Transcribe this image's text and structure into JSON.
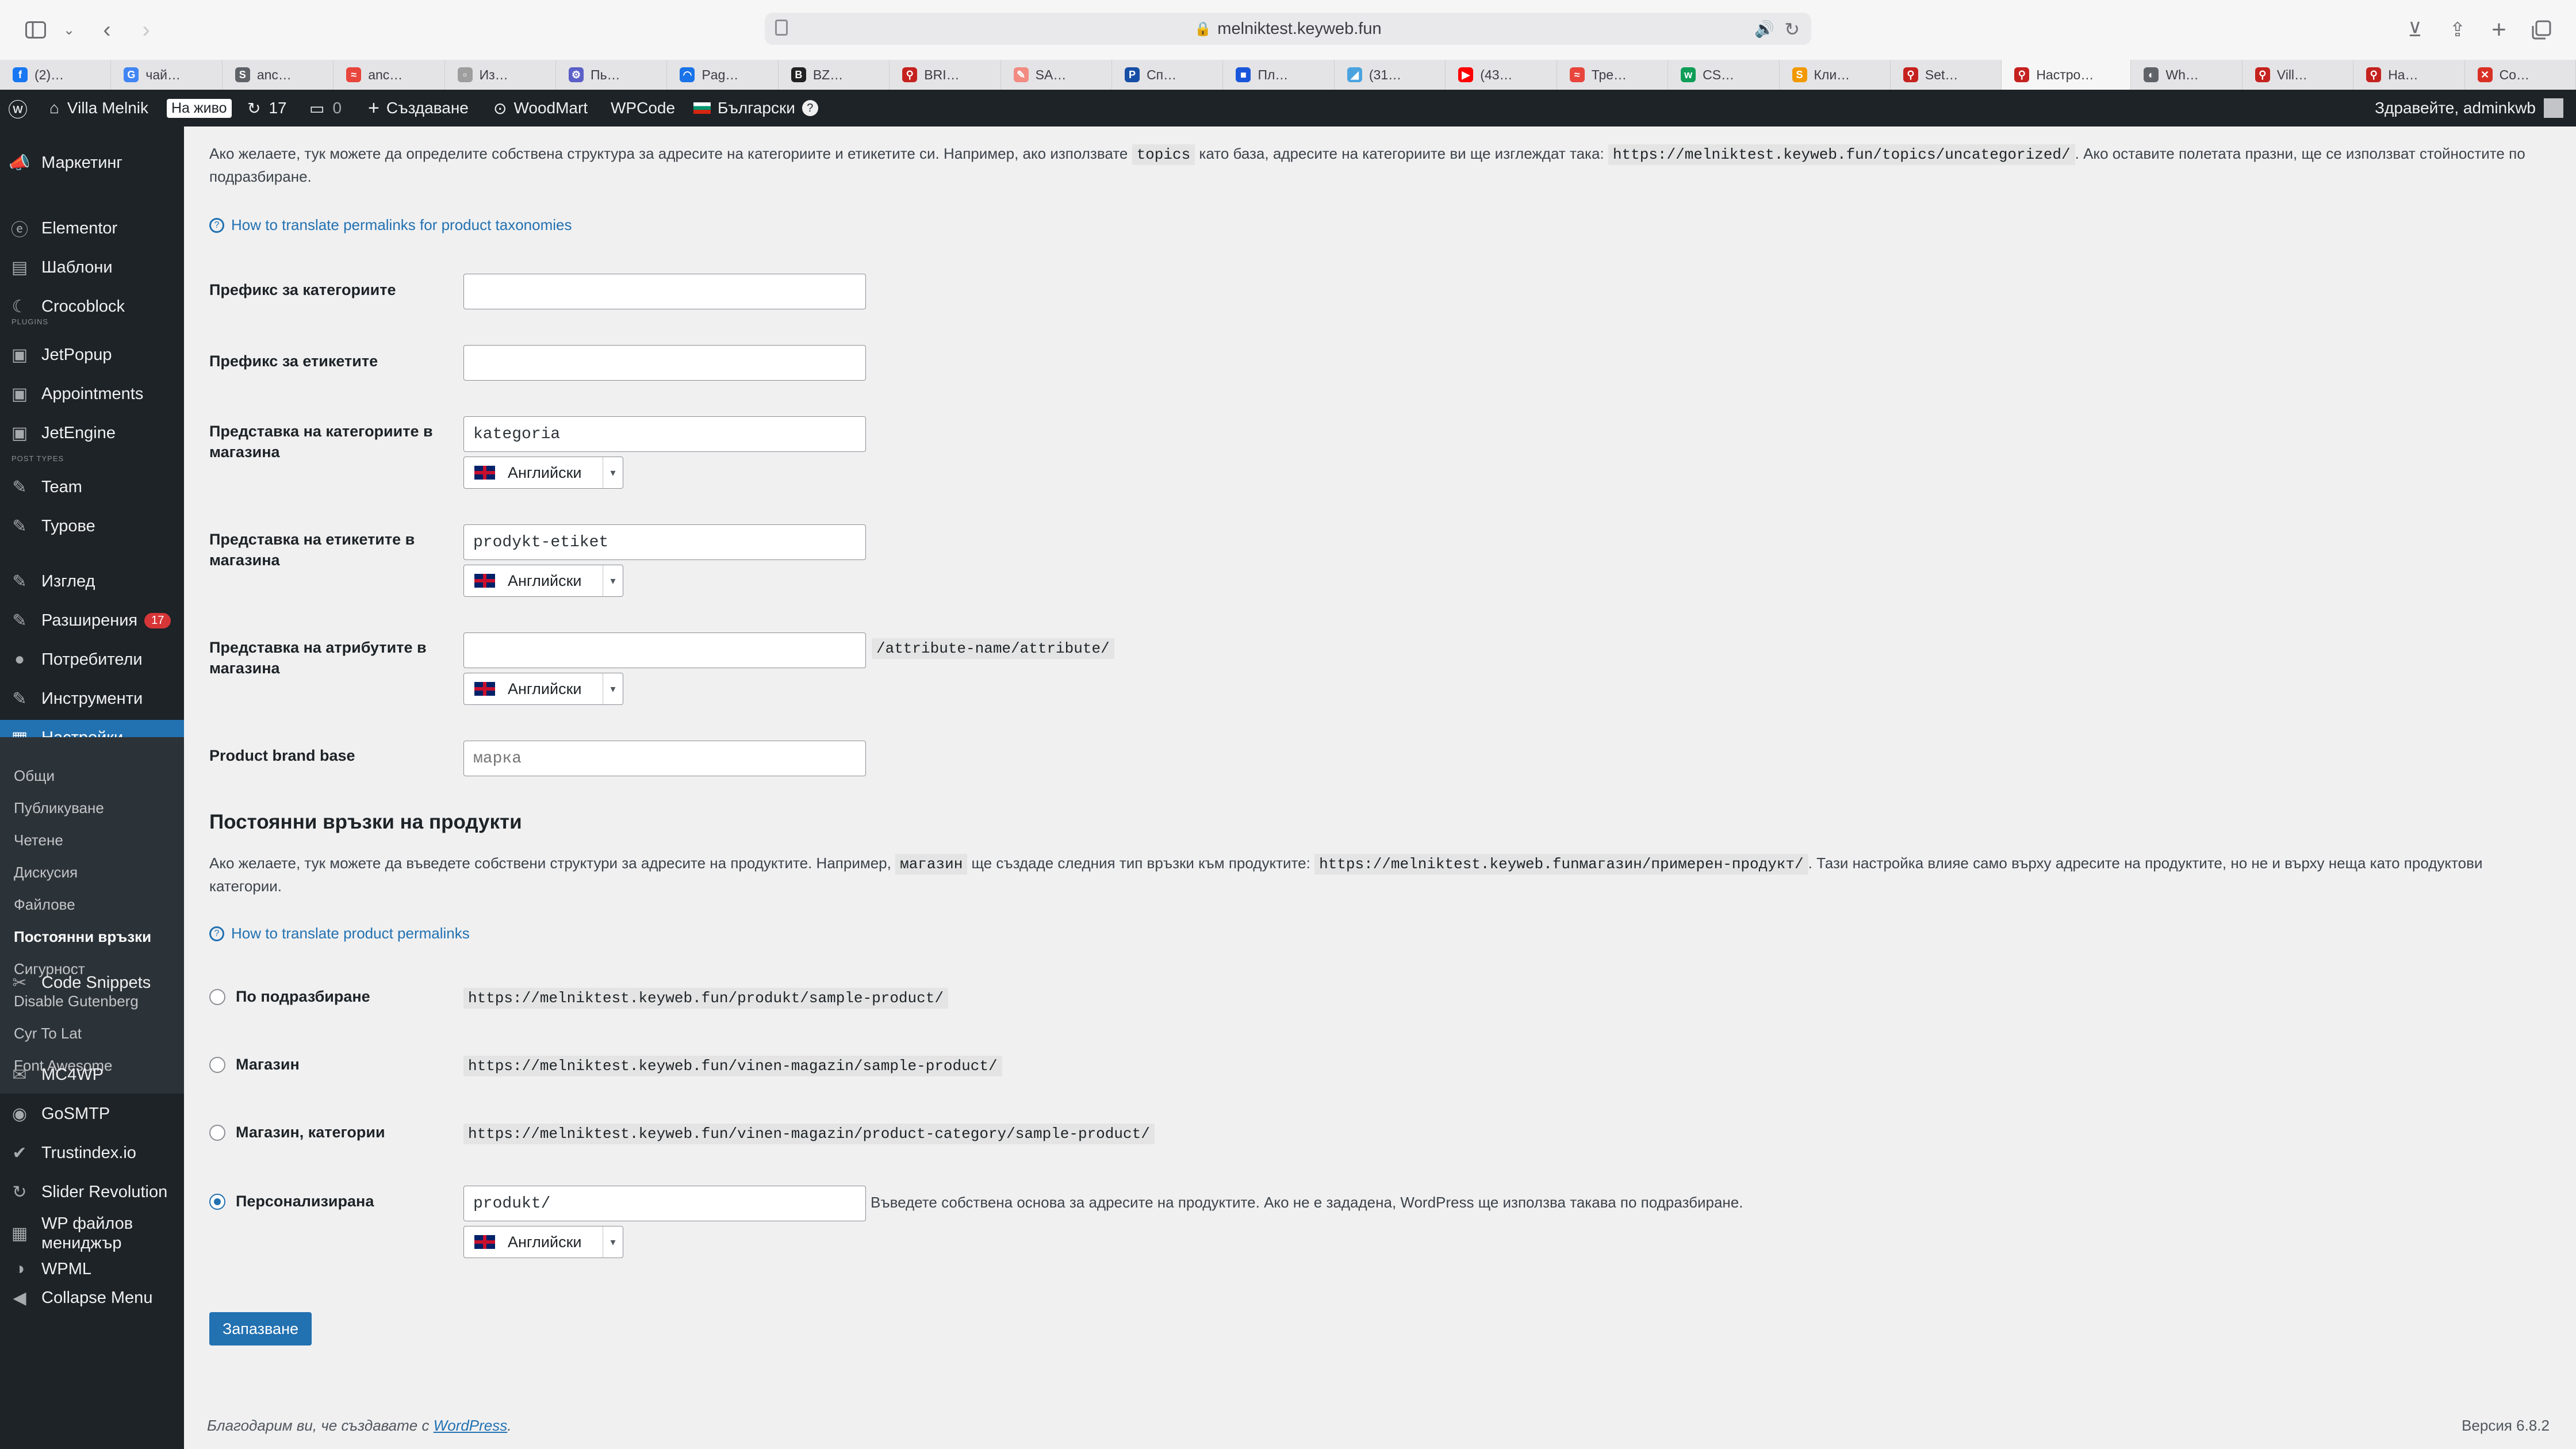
{
  "browser": {
    "url": "melniktest.keyweb.fun",
    "tabs": [
      {
        "label": "(2)…",
        "color": "#1877f2",
        "glyph": "f"
      },
      {
        "label": "чай…",
        "color": "#4285f4",
        "glyph": "G"
      },
      {
        "label": "anc…",
        "color": "#5f6368",
        "glyph": "S"
      },
      {
        "label": "anc…",
        "color": "#e8453c",
        "glyph": "≈"
      },
      {
        "label": "Из…",
        "color": "#9e9e9e",
        "glyph": "▫"
      },
      {
        "label": "Пь…",
        "color": "#5b5fc7",
        "glyph": "⚙"
      },
      {
        "label": "Pag…",
        "color": "#1a73e8",
        "glyph": "◠"
      },
      {
        "label": "BZ…",
        "color": "#222222",
        "glyph": "B"
      },
      {
        "label": "BRI…",
        "color": "#c5221f",
        "glyph": "⚲"
      },
      {
        "label": "SA…",
        "color": "#f28b82",
        "glyph": "✎"
      },
      {
        "label": "Сп…",
        "color": "#174ea6",
        "glyph": "P"
      },
      {
        "label": "Пл…",
        "color": "#1a56db",
        "glyph": "■"
      },
      {
        "label": "(31…",
        "color": "#4aa3df",
        "glyph": "◢"
      },
      {
        "label": "(43…",
        "color": "#ff0000",
        "glyph": "▶"
      },
      {
        "label": "Тре…",
        "color": "#e8453c",
        "glyph": "≈"
      },
      {
        "label": "CS…",
        "color": "#0f9d58",
        "glyph": "w"
      },
      {
        "label": "Кли…",
        "color": "#f29900",
        "glyph": "S"
      },
      {
        "label": "Set…",
        "color": "#c5221f",
        "glyph": "⚲"
      },
      {
        "label": "Настро…",
        "color": "#c5221f",
        "glyph": "⚲",
        "active": true
      },
      {
        "label": "Wh…",
        "color": "#5f6368",
        "glyph": "◐"
      },
      {
        "label": "Vill…",
        "color": "#c5221f",
        "glyph": "⚲"
      },
      {
        "label": "На…",
        "color": "#c5221f",
        "glyph": "⚲"
      },
      {
        "label": "Co…",
        "color": "#d93025",
        "glyph": "✕"
      }
    ]
  },
  "adminbar": {
    "site_name": "Villa Melnik",
    "live_label": "На живо",
    "updates_count": "17",
    "comments_count": "0",
    "new_label": "Създаване",
    "woodmart_label": "WoodMart",
    "wpcode_label": "WPCode",
    "language_label": "Български",
    "greeting": "Здравейте, adminkwb"
  },
  "sidebar": {
    "top_items": [
      {
        "label": "Маркетинг",
        "icon": "megaphone-icon",
        "glyph": "📣"
      },
      {
        "label": "Elementor",
        "icon": "elementor-icon",
        "glyph": "ⓔ"
      },
      {
        "label": "Шаблони",
        "icon": "folder-icon",
        "glyph": "▤"
      },
      {
        "label": "Crocoblock",
        "icon": "crocoblock-icon",
        "glyph": "☾"
      }
    ],
    "plugins_label": "PLUGINS",
    "plugin_items": [
      {
        "label": "JetPopup",
        "icon": "jet-icon",
        "glyph": "▣"
      },
      {
        "label": "Appointments",
        "icon": "jet-icon",
        "glyph": "▣"
      },
      {
        "label": "JetEngine",
        "icon": "jet-icon",
        "glyph": "▣"
      }
    ],
    "post_types_label": "POST TYPES",
    "post_type_items": [
      {
        "label": "Team",
        "icon": "pin-icon",
        "glyph": "✎"
      },
      {
        "label": "Турове",
        "icon": "pin-icon",
        "glyph": "✎"
      }
    ],
    "admin_items": [
      {
        "label": "Изглед",
        "icon": "brush-icon",
        "glyph": "✎"
      },
      {
        "label": "Разширения",
        "icon": "plugin-icon",
        "glyph": "✎",
        "badge": "17"
      },
      {
        "label": "Потребители",
        "icon": "user-icon",
        "glyph": "●"
      },
      {
        "label": "Инструменти",
        "icon": "wrench-icon",
        "glyph": "✎"
      },
      {
        "label": "Настройки",
        "icon": "settings-icon",
        "glyph": "▦",
        "current": true
      }
    ],
    "settings_submenu": [
      {
        "label": "Общи"
      },
      {
        "label": "Публикуване"
      },
      {
        "label": "Четене"
      },
      {
        "label": "Дискусия"
      },
      {
        "label": "Файлове"
      },
      {
        "label": "Постоянни връзки",
        "current": true
      },
      {
        "label": "Сигурност"
      },
      {
        "label": "Disable Gutenberg"
      },
      {
        "label": "Cyr To Lat"
      },
      {
        "label": "Font Awesome"
      }
    ],
    "bottom_items": [
      {
        "label": "Code Snippets",
        "icon": "code-snippets-icon",
        "glyph": "✂"
      },
      {
        "label": "MC4WP",
        "icon": "mc4wp-icon",
        "glyph": "✉"
      },
      {
        "label": "GoSMTP",
        "icon": "gosmtp-icon",
        "glyph": "◉"
      },
      {
        "label": "Trustindex.io",
        "icon": "trustindex-icon",
        "glyph": "✔"
      },
      {
        "label": "Slider Revolution",
        "icon": "slider-revolution-icon",
        "glyph": "↻"
      },
      {
        "label": "WP файлов мениджър",
        "icon": "file-manager-icon",
        "glyph": "▦"
      },
      {
        "label": "WPML",
        "icon": "wpml-icon",
        "glyph": "◑"
      },
      {
        "label": "Collapse Menu",
        "icon": "collapse-icon",
        "glyph": "◀"
      }
    ]
  },
  "taxonomy": {
    "desc_part1": "Ако желаете, тук можете да определите собствена структура за адресите на категориите и етикетите си. Например, ако използвате ",
    "desc_code1": "topics",
    "desc_part2": " като база, адресите на категориите ви ще изглеждат така: ",
    "desc_code2": "https://melniktest.keyweb.fun/topics/uncategorized/",
    "desc_part3": ". Ако оставите полетата празни, ще се използват стойностите по подразбиране.",
    "help_link": "How to translate permalinks for product taxonomies",
    "fields": {
      "category_prefix_label": "Префикс за категориите",
      "category_prefix_value": "",
      "tag_prefix_label": "Префикс за етикетите",
      "tag_prefix_value": "",
      "product_category_label": "Представка на категориите в магазина",
      "product_category_value": "kategoria",
      "product_tag_label": "Представка на етикетите в магазина",
      "product_tag_value": "prodykt-etiket",
      "product_attribute_label": "Представка на атрибутите в магазина",
      "product_attribute_value": "",
      "product_attribute_suffix": "/attribute-name/attribute/",
      "brand_base_label": "Product brand base",
      "brand_base_placeholder": "марка"
    },
    "language_option": "Английски"
  },
  "product_permalinks": {
    "title": "Постоянни връзки на продукти",
    "desc_part1": "Ако желаете, тук можете да въведете собствени структури за адресите на продуктите. Например, ",
    "desc_code1": "магазин",
    "desc_part2": " ще създаде следния тип връзки към продуктите: ",
    "desc_code2": "https://melniktest.keyweb.funмагазин/примерен-продукт/",
    "desc_part3": ". Тази настройка влияе само върху адресите на продуктите, но не и върху неща като продуктови категории.",
    "help_link": "How to translate product permalinks",
    "options": [
      {
        "label": "По подразбиране",
        "url": "https://melniktest.keyweb.fun/produkt/sample-product/",
        "checked": false
      },
      {
        "label": "Магазин",
        "url": "https://melniktest.keyweb.fun/vinen-magazin/sample-product/",
        "checked": false
      },
      {
        "label": "Магазин, категории",
        "url": "https://melniktest.keyweb.fun/vinen-magazin/product-category/sample-product/",
        "checked": false
      },
      {
        "label": "Персонализирана",
        "checked": true
      }
    ],
    "custom_value": "produkt/",
    "custom_hint": "Въведете собствена основа за адресите на продуктите. Ако не е зададена, WordPress ще използва такава по подразбиране."
  },
  "save_label": "Запазване",
  "footer": {
    "thanks_text": "Благодарим ви, че създавате с ",
    "wordpress_link": "WordPress",
    "thanks_end": ".",
    "version": "Версия 6.8.2"
  }
}
